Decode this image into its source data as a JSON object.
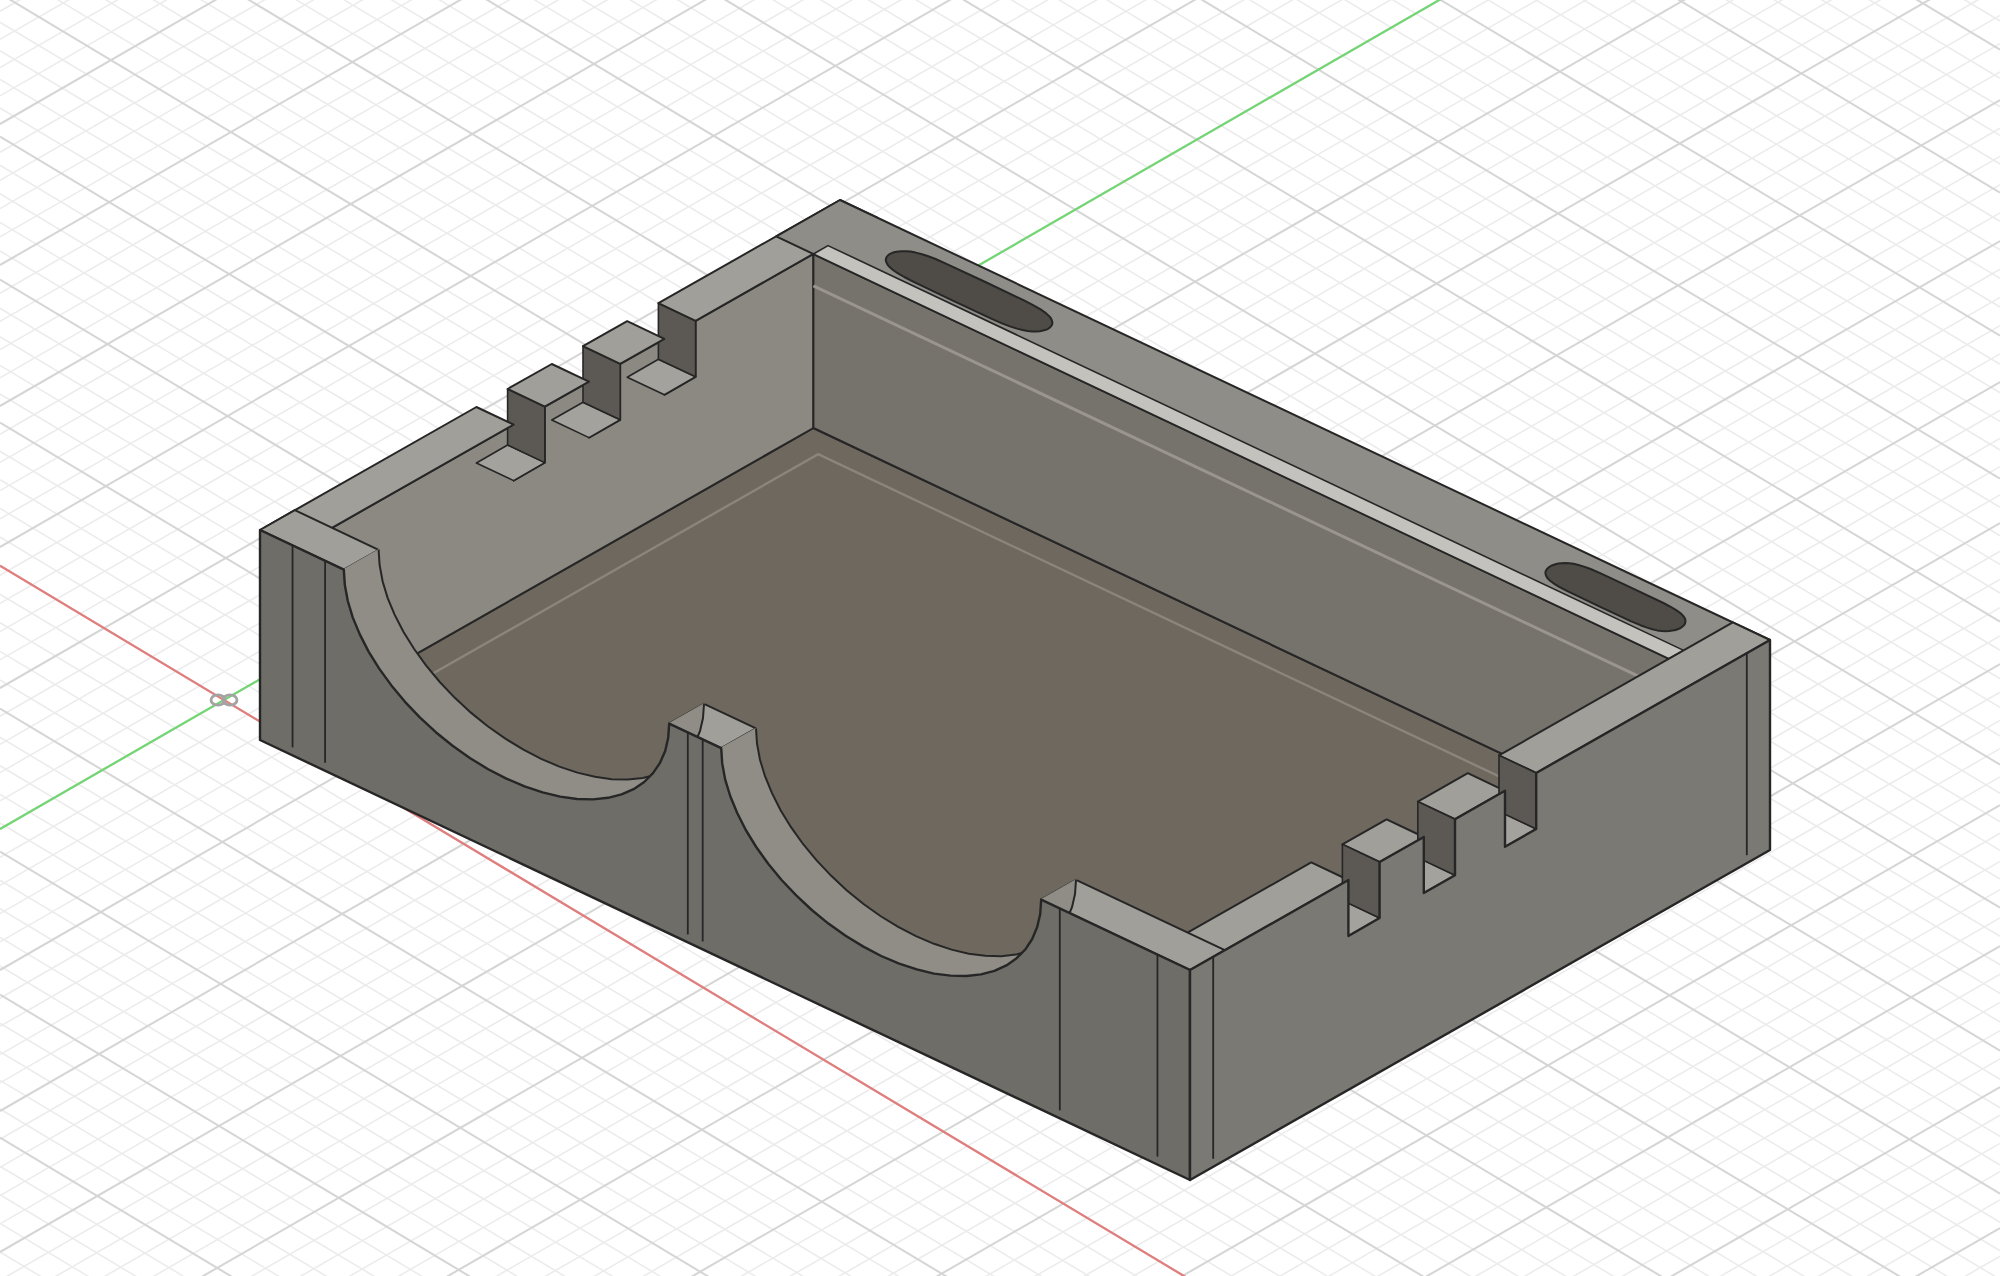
{
  "viewport": {
    "show_grid": true,
    "axes": [
      {
        "kind": "x",
        "color": "#e27d7d"
      },
      {
        "kind": "y",
        "color": "#72d672"
      }
    ],
    "show_origin": true,
    "model": {
      "kind": "tray"
    }
  }
}
